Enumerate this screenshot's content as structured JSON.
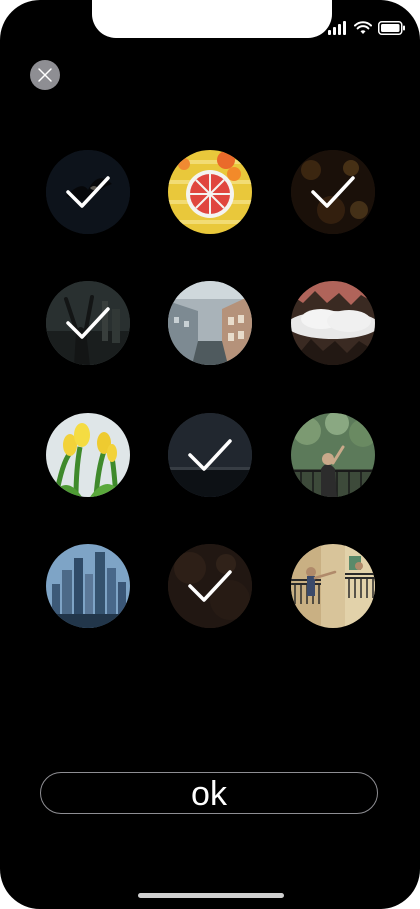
{
  "status_bar": {
    "icons": [
      "cellular-signal-icon",
      "wifi-icon",
      "battery-icon"
    ]
  },
  "toolbar": {
    "close_icon": "close-icon"
  },
  "grid": {
    "tiles": [
      {
        "subject": "eagle",
        "selected": true
      },
      {
        "subject": "watermelon",
        "selected": false
      },
      {
        "subject": "bokeh-lights",
        "selected": true
      },
      {
        "subject": "person-raised-arms",
        "selected": true
      },
      {
        "subject": "city-street",
        "selected": false
      },
      {
        "subject": "clouds-over-forest",
        "selected": false
      },
      {
        "subject": "yellow-tulips",
        "selected": false
      },
      {
        "subject": "horizon",
        "selected": true
      },
      {
        "subject": "person-on-balcony",
        "selected": false
      },
      {
        "subject": "city-skyline",
        "selected": false
      },
      {
        "subject": "blurred-warm",
        "selected": true
      },
      {
        "subject": "people-on-balconies",
        "selected": false
      }
    ]
  },
  "footer": {
    "ok_label": "ok"
  },
  "colors": {
    "background": "#000000",
    "close_button": "#8e8e93",
    "check": "#ffffff",
    "button_border": "#8e8e93"
  }
}
